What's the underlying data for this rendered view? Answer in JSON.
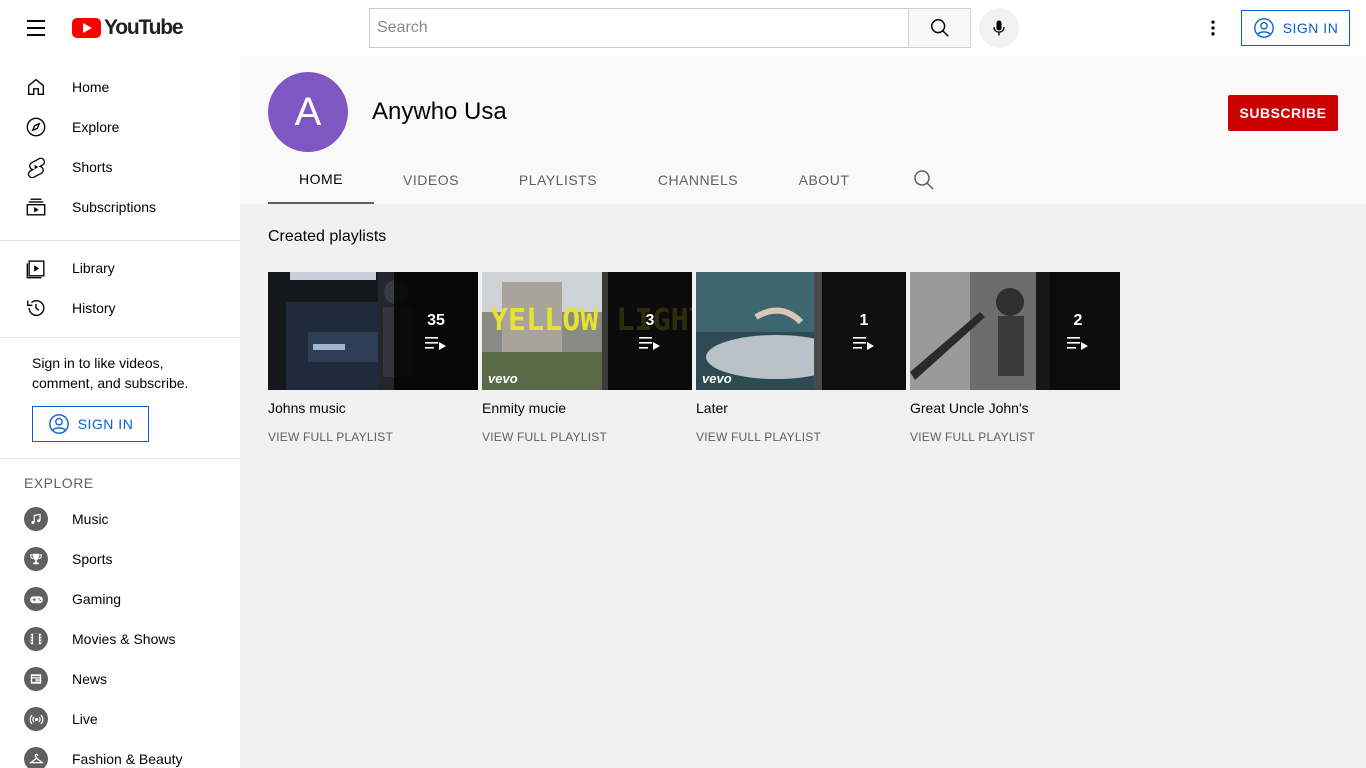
{
  "header": {
    "logo_text": "YouTube",
    "search_placeholder": "Search",
    "signin_label": "SIGN IN"
  },
  "sidebar": {
    "items": [
      {
        "label": "Home",
        "icon": "home-icon"
      },
      {
        "label": "Explore",
        "icon": "explore-icon"
      },
      {
        "label": "Shorts",
        "icon": "shorts-icon"
      },
      {
        "label": "Subscriptions",
        "icon": "subscriptions-icon"
      },
      {
        "label": "Library",
        "icon": "library-icon"
      },
      {
        "label": "History",
        "icon": "history-icon"
      }
    ],
    "signin_text": "Sign in to like videos, comment, and subscribe.",
    "signin_label": "SIGN IN",
    "explore_title": "EXPLORE",
    "explore_items": [
      {
        "label": "Music",
        "icon": "music-icon"
      },
      {
        "label": "Sports",
        "icon": "trophy-icon"
      },
      {
        "label": "Gaming",
        "icon": "gaming-icon"
      },
      {
        "label": "Movies & Shows",
        "icon": "film-icon"
      },
      {
        "label": "News",
        "icon": "news-icon"
      },
      {
        "label": "Live",
        "icon": "live-icon"
      },
      {
        "label": "Fashion & Beauty",
        "icon": "hanger-icon"
      }
    ]
  },
  "channel": {
    "avatar_letter": "A",
    "avatar_color": "#7e57c2",
    "name": "Anywho Usa",
    "subscribe_label": "SUBSCRIBE",
    "subscribe_color": "#cc0000",
    "tabs": [
      "HOME",
      "VIDEOS",
      "PLAYLISTS",
      "CHANNELS",
      "ABOUT"
    ],
    "active_tab": "HOME"
  },
  "content": {
    "section_title": "Created playlists",
    "playlists": [
      {
        "title": "Johns music",
        "count": "35",
        "link": "VIEW FULL PLAYLIST"
      },
      {
        "title": "Enmity mucie",
        "count": "3",
        "link": "VIEW FULL PLAYLIST",
        "thumb_text": "YELLOW LIGHT"
      },
      {
        "title": "Later",
        "count": "1",
        "link": "VIEW FULL PLAYLIST"
      },
      {
        "title": "Great Uncle John's",
        "count": "2",
        "link": "VIEW FULL PLAYLIST"
      }
    ]
  }
}
